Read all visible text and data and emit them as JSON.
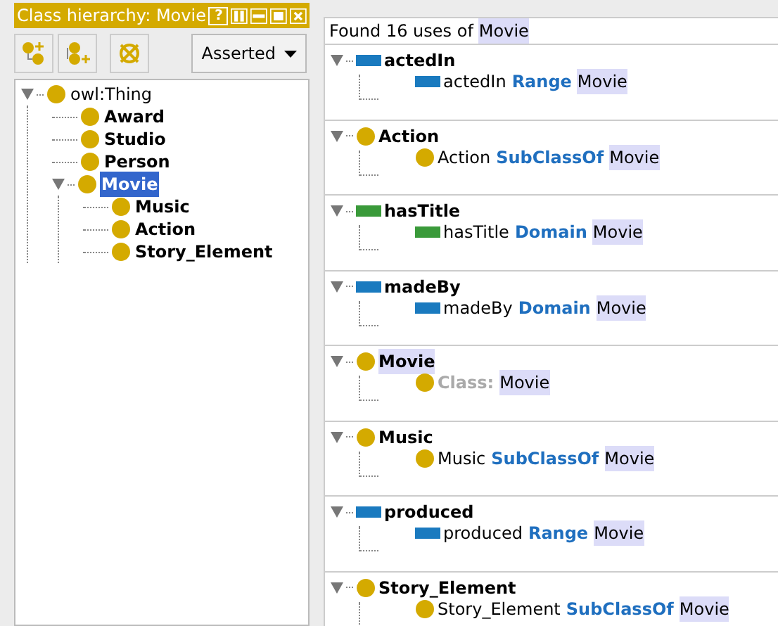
{
  "hierarchy_panel": {
    "title": "Class hierarchy: Movie",
    "title_buttons": [
      "?"
    ],
    "mode_dropdown": "Asserted",
    "tree": [
      {
        "label": "owl:Thing",
        "bold": false,
        "expanded": true,
        "selected": false,
        "children": [
          {
            "label": "Award",
            "bold": true,
            "selected": false
          },
          {
            "label": "Studio",
            "bold": true,
            "selected": false
          },
          {
            "label": "Person",
            "bold": true,
            "selected": false
          },
          {
            "label": "Movie",
            "bold": true,
            "expanded": true,
            "selected": true,
            "children": [
              {
                "label": "Music",
                "bold": true,
                "selected": false
              },
              {
                "label": "Action",
                "bold": true,
                "selected": false
              },
              {
                "label": "Story_Element",
                "bold": true,
                "selected": false
              }
            ]
          }
        ]
      }
    ]
  },
  "usage_panel": {
    "header_prefix": "Found 16 uses of",
    "header_entity": "Movie",
    "groups": [
      {
        "kind": "object_property",
        "name": "actedIn",
        "highlighted": false,
        "expanded": true,
        "usage": {
          "kind": "axiom",
          "subject": "actedIn",
          "keyword": "Range",
          "object": "Movie"
        }
      },
      {
        "kind": "class",
        "name": "Action",
        "highlighted": false,
        "expanded": true,
        "usage": {
          "kind": "axiom",
          "subject": "Action",
          "keyword": "SubClassOf",
          "object": "Movie"
        }
      },
      {
        "kind": "data_property",
        "name": "hasTitle",
        "highlighted": false,
        "expanded": true,
        "usage": {
          "kind": "axiom",
          "subject": "hasTitle",
          "keyword": "Domain",
          "object": "Movie"
        }
      },
      {
        "kind": "object_property",
        "name": "madeBy",
        "highlighted": false,
        "expanded": true,
        "usage": {
          "kind": "axiom",
          "subject": "madeBy",
          "keyword": "Domain",
          "object": "Movie"
        }
      },
      {
        "kind": "class",
        "name": "Movie",
        "highlighted": true,
        "expanded": true,
        "usage": {
          "kind": "declaration",
          "keyword": "Class:",
          "object": "Movie"
        }
      },
      {
        "kind": "class",
        "name": "Music",
        "highlighted": false,
        "expanded": true,
        "usage": {
          "kind": "axiom",
          "subject": "Music",
          "keyword": "SubClassOf",
          "object": "Movie"
        }
      },
      {
        "kind": "object_property",
        "name": "produced",
        "highlighted": false,
        "expanded": true,
        "usage": {
          "kind": "axiom",
          "subject": "produced",
          "keyword": "Range",
          "object": "Movie"
        }
      },
      {
        "kind": "class",
        "name": "Story_Element",
        "highlighted": false,
        "expanded": true,
        "usage": {
          "kind": "axiom",
          "subject": "Story_Element",
          "keyword": "SubClassOf",
          "object": "Movie"
        }
      }
    ]
  }
}
